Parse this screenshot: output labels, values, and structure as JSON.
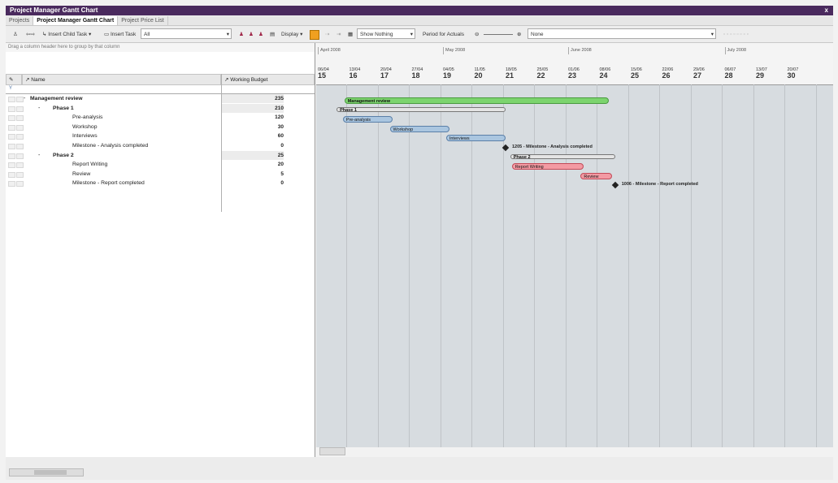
{
  "window": {
    "title": "Project Manager Gantt Chart",
    "close": "x"
  },
  "tabs": [
    {
      "label": "Projects"
    },
    {
      "label": "Project Manager Gantt Chart"
    },
    {
      "label": "Project Price List"
    }
  ],
  "toolbar": {
    "insert_child_task": "Insert Child Task",
    "insert_task": "Insert Task",
    "filter_value": "All",
    "display": "Display",
    "show_value": "Show Nothing",
    "period_actuals": "Period for Actuals",
    "none_value": "None"
  },
  "grid": {
    "group_hint": "Drag a column header here to group by that column",
    "col_name": "Name",
    "col_budget": "Working Budget",
    "filter_icon": "Y",
    "rows": [
      {
        "name": "Management review",
        "budget": "235",
        "level": 0,
        "bold": true,
        "toggle": "-"
      },
      {
        "name": "Phase 1",
        "budget": "210",
        "level": 1,
        "bold": true,
        "toggle": "-"
      },
      {
        "name": "Pre-analysis",
        "budget": "120",
        "level": 2,
        "bold": false,
        "toggle": ""
      },
      {
        "name": "Workshop",
        "budget": "30",
        "level": 2,
        "bold": false,
        "toggle": ""
      },
      {
        "name": "Interviews",
        "budget": "60",
        "level": 2,
        "bold": false,
        "toggle": ""
      },
      {
        "name": "Milestone - Analysis completed",
        "budget": "0",
        "level": 2,
        "bold": false,
        "toggle": ""
      },
      {
        "name": "Phase 2",
        "budget": "25",
        "level": 1,
        "bold": true,
        "toggle": "-"
      },
      {
        "name": "Report Writing",
        "budget": "20",
        "level": 2,
        "bold": false,
        "toggle": ""
      },
      {
        "name": "Review",
        "budget": "5",
        "level": 2,
        "bold": false,
        "toggle": ""
      },
      {
        "name": "Milestone - Report completed",
        "budget": "0",
        "level": 2,
        "bold": false,
        "toggle": ""
      }
    ]
  },
  "timeline": {
    "months": [
      {
        "label": "April 2008",
        "pos": 0
      },
      {
        "label": "May 2008",
        "pos": 4
      },
      {
        "label": "June 2008",
        "pos": 8
      },
      {
        "label": "July 2008",
        "pos": 13
      }
    ],
    "weeks": [
      {
        "date": "06/04",
        "num": "15"
      },
      {
        "date": "13/04",
        "num": "16"
      },
      {
        "date": "20/04",
        "num": "17"
      },
      {
        "date": "27/04",
        "num": "18"
      },
      {
        "date": "04/05",
        "num": "19"
      },
      {
        "date": "11/05",
        "num": "20"
      },
      {
        "date": "18/05",
        "num": "21"
      },
      {
        "date": "25/05",
        "num": "22"
      },
      {
        "date": "01/06",
        "num": "23"
      },
      {
        "date": "08/06",
        "num": "24"
      },
      {
        "date": "15/06",
        "num": "25"
      },
      {
        "date": "22/06",
        "num": "26"
      },
      {
        "date": "29/06",
        "num": "27"
      },
      {
        "date": "06/07",
        "num": "28"
      },
      {
        "date": "13/07",
        "num": "29"
      },
      {
        "date": "20/07",
        "num": "30"
      }
    ]
  },
  "gantt": {
    "bars": [
      {
        "name": "Management review",
        "label": "Management review",
        "color": "green",
        "start": 0.85,
        "end": 9.3,
        "row": 0
      },
      {
        "name": "Phase 1",
        "label": "Phase 1",
        "color": "gray",
        "start": 0.6,
        "end": 6.0,
        "row": 1
      },
      {
        "name": "Pre-analysis",
        "label": "Pre-analysis",
        "color": "blue",
        "start": 0.8,
        "end": 2.4,
        "row": 2
      },
      {
        "name": "Workshop",
        "label": "Workshop",
        "color": "blue",
        "start": 2.3,
        "end": 4.2,
        "row": 3
      },
      {
        "name": "Interviews",
        "label": "Interviews",
        "color": "blue",
        "start": 4.1,
        "end": 6.0,
        "row": 4
      },
      {
        "name": "Phase 2",
        "label": "Phase 2",
        "color": "gray",
        "start": 6.15,
        "end": 9.5,
        "row": 6
      },
      {
        "name": "Report Writing",
        "label": "Report Writing",
        "color": "red",
        "start": 6.2,
        "end": 8.5,
        "row": 7
      },
      {
        "name": "Review",
        "label": "Review",
        "color": "red",
        "start": 8.4,
        "end": 9.4,
        "row": 8
      }
    ],
    "milestones": [
      {
        "label": "1205 - Milestone - Analysis completed",
        "at": 6.0,
        "row": 5
      },
      {
        "label": "1006 - Milestone - Report completed",
        "at": 9.5,
        "row": 9
      }
    ]
  }
}
